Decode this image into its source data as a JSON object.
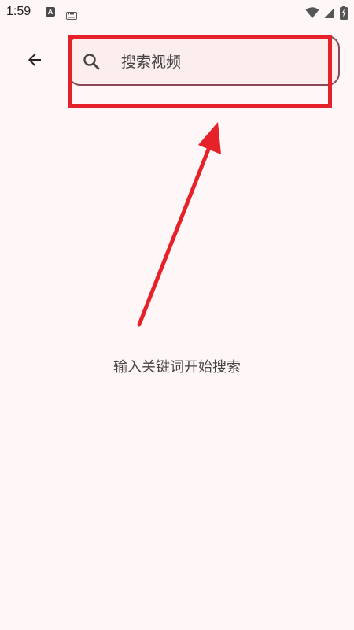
{
  "status_bar": {
    "time": "1:59",
    "a_icon_label": "A",
    "icons": [
      "keyboard-icon",
      "wifi-icon",
      "signal-icon",
      "battery-icon"
    ]
  },
  "header": {
    "back_icon": "arrow-left-icon",
    "search": {
      "placeholder": "搜索视频",
      "value": "",
      "icon": "search-icon"
    }
  },
  "main": {
    "hint": "输入关键词开始搜索"
  },
  "annotation": {
    "highlight_color": "#e62129"
  },
  "colors": {
    "background": "#fff7f7",
    "search_border": "#8a4a5a",
    "search_fill": "#fdeeee"
  }
}
